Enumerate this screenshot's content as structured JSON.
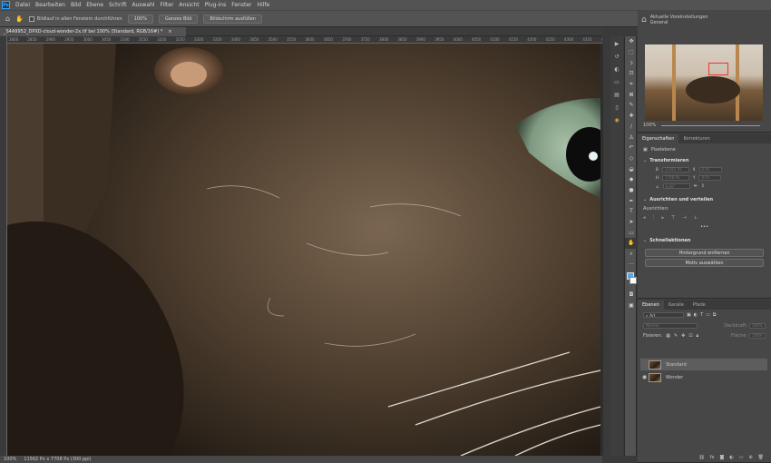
{
  "app": {
    "logo": "Ps"
  },
  "menu": [
    "Datei",
    "Bearbeiten",
    "Bild",
    "Ebene",
    "Schrift",
    "Auswahl",
    "Filter",
    "Ansicht",
    "Plug-ins",
    "Fenster",
    "Hilfe"
  ],
  "options": {
    "tool_icon": "hand-icon",
    "checkbox_label": "Bildlauf in allen Fenstern durchführen",
    "btn_100": "100%",
    "btn_fit": "Ganzes Bild",
    "btn_fill": "Bildschirm ausfüllen"
  },
  "document": {
    "tab_title": "_S4A9952_DPXD-cloud-wonder-2x.tif bei 100% (Standard, RGB/16#) *",
    "ruler_ticks": [
      "2800",
      "2850",
      "2900",
      "2950",
      "3000",
      "3050",
      "3100",
      "3150",
      "3200",
      "3250",
      "3300",
      "3350",
      "3400",
      "3450",
      "3500",
      "3550",
      "3600",
      "3650",
      "3700",
      "3750",
      "3800",
      "3850",
      "3900",
      "3950",
      "4000",
      "4050",
      "4100",
      "4150",
      "4200",
      "4250",
      "4300",
      "4350",
      "4400"
    ]
  },
  "status": {
    "zoom": "100%",
    "info": "11562 Px x 7708 Px (300 ppi)"
  },
  "navigator": {
    "preset_title": "Aktuelle Voreinstellungen",
    "preset_value": "General",
    "zoom": "100%"
  },
  "properties": {
    "tabs": [
      "Eigenschaften",
      "Korrekturen"
    ],
    "pixel_layer": "Pixelebene",
    "transform_heading": "Transformieren",
    "w_val": "11562 Px",
    "h_val": "7708 Px",
    "x_val": "0 Px",
    "y_val": "0 Px",
    "angle_val": "0,00°",
    "align_heading": "Ausrichten und verteilen",
    "align_label": "Ausrichten:",
    "quick_heading": "Schnellaktionen",
    "quick_btn1": "Hintergrund entfernen",
    "quick_btn2": "Motiv auswählen"
  },
  "layers": {
    "tabs": [
      "Ebenen",
      "Kanäle",
      "Pfade"
    ],
    "filter_kind": "Art",
    "blend_mode": "Normal",
    "opacity_label": "Deckkraft:",
    "opacity_val": "100%",
    "lock_label": "Fixieren:",
    "fill_label": "Fläche:",
    "fill_val": "100%",
    "items": [
      {
        "name": "Standard"
      },
      {
        "name": "Wonder"
      }
    ]
  },
  "colors": {
    "accent": "#31a8ff",
    "panel": "#474747",
    "fg_swatch": "#5aa8e6",
    "bg_swatch": "#ffffff"
  }
}
